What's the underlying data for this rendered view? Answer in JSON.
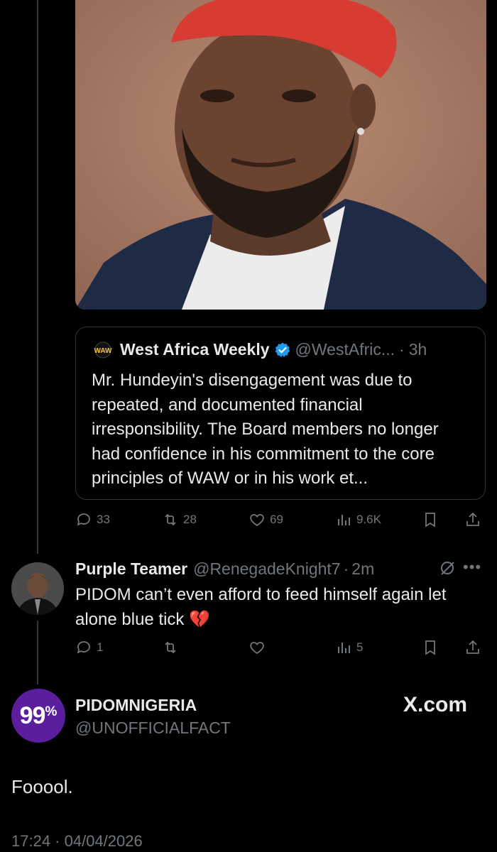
{
  "quoted_tweet": {
    "author_name": "West Africa Weekly",
    "author_handle": "@WestAfric...",
    "separator": "·",
    "time": "3h",
    "text": "Mr. Hundeyin's disengagement was due to repeated, and documented financial irresponsibility. The Board members no longer had confidence in his commitment to the core principles of WAW or in his work et...",
    "avatar_icon": "waw-logo-icon",
    "verified_icon": "verified-badge-icon",
    "verified_color": "#1d9bf0"
  },
  "parent_tweet_actions": {
    "replies": "33",
    "retweets": "28",
    "likes": "69",
    "views": "9.6K"
  },
  "reply_tweet": {
    "author_name": "Purple Teamer",
    "author_handle": "@RenegadeKnight7",
    "separator": "·",
    "time": "2m",
    "text": "PIDOM can’t even afford to feed himself again let alone blue tick 💔",
    "actions": {
      "replies": "1",
      "retweets": "",
      "likes": "",
      "views": "5"
    }
  },
  "overlay": {
    "badge_number": "99",
    "badge_symbol": "%",
    "badge_color": "#5b1e9e",
    "account_name": "PIDOMNIGERIA",
    "account_handle": "@UNOFFICIALFACT",
    "brand": "X.com",
    "main_text": "Fooool.",
    "timestamp": "17:24 · 04/04/2026"
  },
  "colors": {
    "background": "#000000",
    "text_primary": "#e7e9ea",
    "text_secondary": "#71767b",
    "border": "#2f3336"
  }
}
